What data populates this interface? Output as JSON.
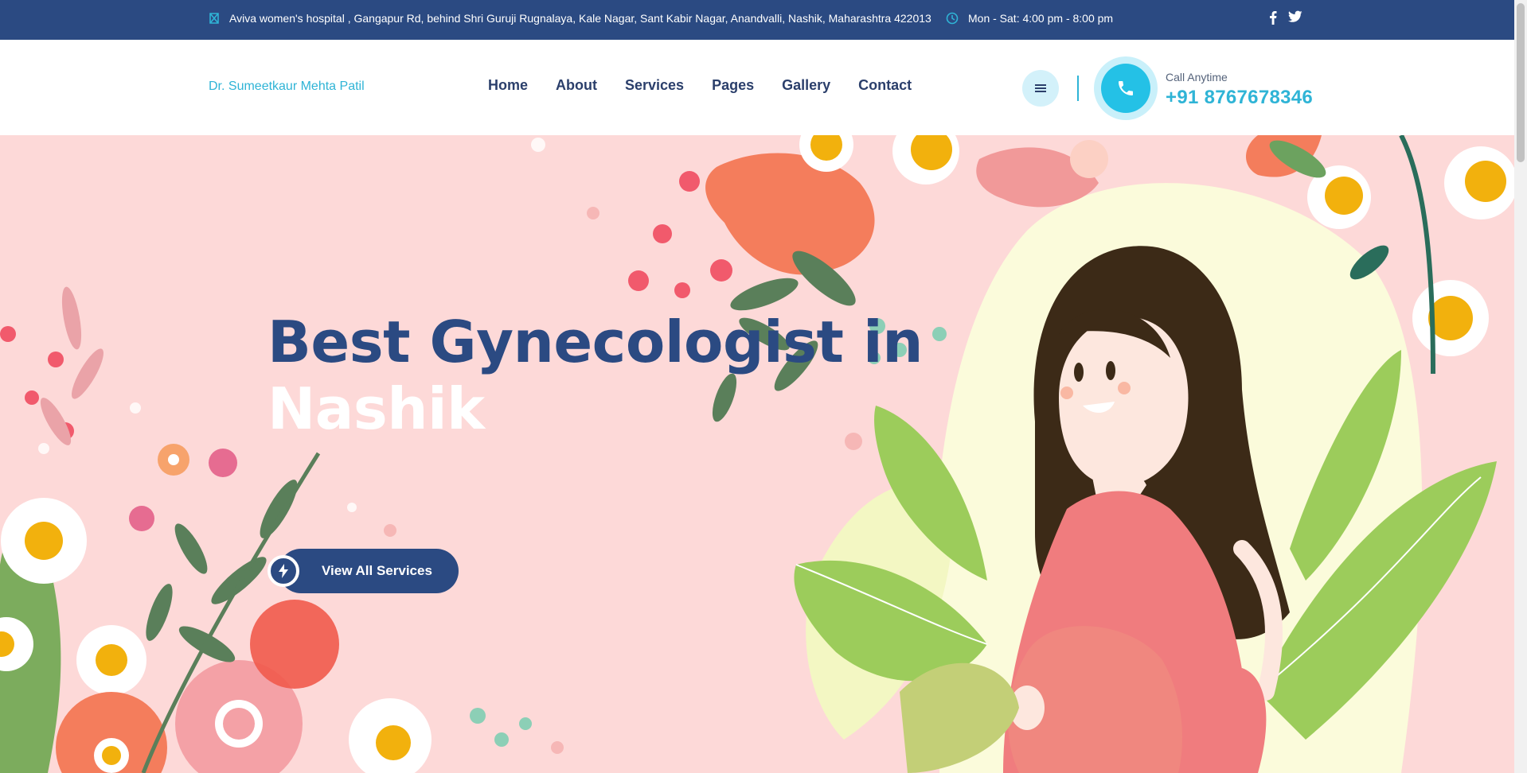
{
  "topbar": {
    "address": "Aviva women's hospital , Gangapur Rd, behind Shri Guruji Rugnalaya, Kale Nagar, Sant Kabir Nagar, Anandvalli, Nashik, Maharashtra 422013",
    "hours": "Mon - Sat: 4:00 pm - 8:00 pm",
    "icons": [
      "map-icon",
      "clock-icon",
      "facebook-icon",
      "twitter-icon"
    ]
  },
  "header": {
    "brand": "Dr. Sumeetkaur Mehta Patil",
    "nav": [
      {
        "label": "Home"
      },
      {
        "label": "About"
      },
      {
        "label": "Services"
      },
      {
        "label": "Pages"
      },
      {
        "label": "Gallery"
      },
      {
        "label": "Contact"
      }
    ],
    "call_label": "Call Anytime",
    "call_number": "+91 8767678346"
  },
  "hero": {
    "title_line1": "Best Gynecologist in",
    "title_line2": "Nashik",
    "cta_label": "View All Services"
  },
  "colors": {
    "primary": "#2b4a82",
    "accent": "#2fb4d6",
    "hero_bg": "#fdd9d8"
  }
}
